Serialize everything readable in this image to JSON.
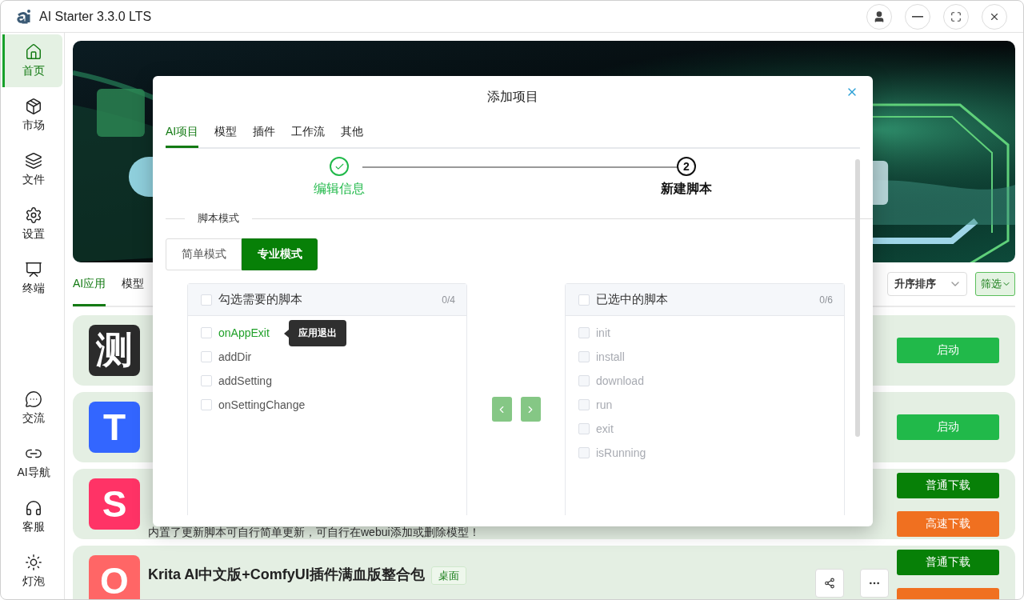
{
  "window": {
    "title": "AI Starter 3.3.0 LTS"
  },
  "sidebar": {
    "top": [
      {
        "label": "首页",
        "selected": true
      },
      {
        "label": "市场",
        "selected": false
      },
      {
        "label": "文件",
        "selected": false
      },
      {
        "label": "设置",
        "selected": false
      },
      {
        "label": "终端",
        "selected": false
      }
    ],
    "bottom": [
      {
        "label": "交流",
        "selected": false
      },
      {
        "label": "AI导航",
        "selected": false
      },
      {
        "label": "客服",
        "selected": false
      },
      {
        "label": "灯泡",
        "selected": false
      }
    ]
  },
  "content_tabs": [
    {
      "label": "AI应用",
      "selected": true
    },
    {
      "label": "模型",
      "selected": false
    }
  ],
  "sort_select": {
    "value": "升序排序"
  },
  "filter_button": {
    "label": "筛选"
  },
  "cards": [
    {
      "icon_text": "测",
      "color": "#2b2b2b",
      "buttons": [
        {
          "kind": "start",
          "label": "启动"
        }
      ]
    },
    {
      "icon_text": "T",
      "color": "#3366ff",
      "buttons": [
        {
          "kind": "start",
          "label": "启动"
        }
      ]
    },
    {
      "icon_text": "S",
      "color": "#ff3366",
      "description_tail": "内置了更新脚本可自行简单更新，可自行在webui添加或删除模型！",
      "buttons": [
        {
          "kind": "download",
          "label": "普通下载"
        },
        {
          "kind": "fast",
          "label": "高速下载"
        }
      ]
    },
    {
      "icon_text": "O",
      "color": "#ff6666",
      "title": "Krita AI中文版+ComfyUI插件满血版整合包",
      "tag": "桌面",
      "tools": true,
      "buttons": [
        {
          "kind": "download",
          "label": "普通下载"
        },
        {
          "kind": "fast"
        }
      ]
    }
  ],
  "dialog": {
    "title": "添加项目",
    "tabs": [
      {
        "label": "AI项目",
        "selected": true
      },
      {
        "label": "模型",
        "selected": false
      },
      {
        "label": "插件",
        "selected": false
      },
      {
        "label": "工作流",
        "selected": false
      },
      {
        "label": "其他",
        "selected": false
      }
    ],
    "steps": [
      {
        "label": "编辑信息",
        "done": true
      },
      {
        "number": "2",
        "label": "新建脚本",
        "done": false
      }
    ],
    "section_label": "脚本模式",
    "modes": [
      {
        "label": "简单模式",
        "selected": false
      },
      {
        "label": "专业模式",
        "selected": true
      }
    ],
    "source": {
      "title": "勾选需要的脚本",
      "count": "0/4",
      "checked": false,
      "items": [
        {
          "label": "onAppExit",
          "checked": false,
          "hovered": true,
          "tooltip": "应用退出",
          "disabled": false
        },
        {
          "label": "addDir",
          "checked": false,
          "hovered": false,
          "disabled": false
        },
        {
          "label": "addSetting",
          "checked": false,
          "hovered": false,
          "disabled": false
        },
        {
          "label": "onSettingChange",
          "checked": false,
          "hovered": false,
          "disabled": false
        }
      ]
    },
    "target": {
      "title": "已选中的脚本",
      "count": "0/6",
      "checked": false,
      "items": [
        {
          "label": "init",
          "checked": false,
          "disabled": true
        },
        {
          "label": "install",
          "checked": false,
          "disabled": true
        },
        {
          "label": "download",
          "checked": false,
          "disabled": true
        },
        {
          "label": "run",
          "checked": false,
          "disabled": true
        },
        {
          "label": "exit",
          "checked": false,
          "disabled": true
        },
        {
          "label": "isRunning",
          "checked": false,
          "disabled": true
        }
      ]
    }
  }
}
